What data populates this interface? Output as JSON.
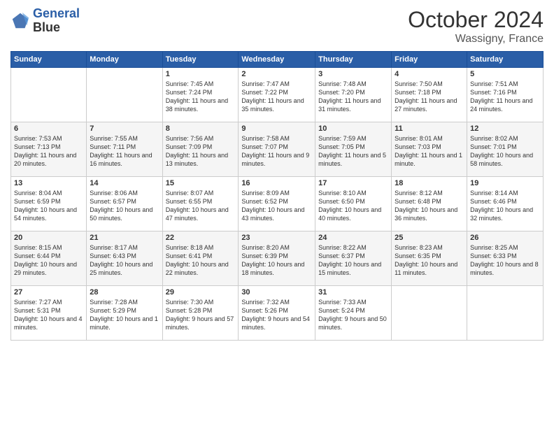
{
  "header": {
    "logo_line1": "General",
    "logo_line2": "Blue",
    "month": "October 2024",
    "location": "Wassigny, France"
  },
  "days_of_week": [
    "Sunday",
    "Monday",
    "Tuesday",
    "Wednesday",
    "Thursday",
    "Friday",
    "Saturday"
  ],
  "weeks": [
    [
      {
        "day": "",
        "sunrise": "",
        "sunset": "",
        "daylight": ""
      },
      {
        "day": "",
        "sunrise": "",
        "sunset": "",
        "daylight": ""
      },
      {
        "day": "1",
        "sunrise": "Sunrise: 7:45 AM",
        "sunset": "Sunset: 7:24 PM",
        "daylight": "Daylight: 11 hours and 38 minutes."
      },
      {
        "day": "2",
        "sunrise": "Sunrise: 7:47 AM",
        "sunset": "Sunset: 7:22 PM",
        "daylight": "Daylight: 11 hours and 35 minutes."
      },
      {
        "day": "3",
        "sunrise": "Sunrise: 7:48 AM",
        "sunset": "Sunset: 7:20 PM",
        "daylight": "Daylight: 11 hours and 31 minutes."
      },
      {
        "day": "4",
        "sunrise": "Sunrise: 7:50 AM",
        "sunset": "Sunset: 7:18 PM",
        "daylight": "Daylight: 11 hours and 27 minutes."
      },
      {
        "day": "5",
        "sunrise": "Sunrise: 7:51 AM",
        "sunset": "Sunset: 7:16 PM",
        "daylight": "Daylight: 11 hours and 24 minutes."
      }
    ],
    [
      {
        "day": "6",
        "sunrise": "Sunrise: 7:53 AM",
        "sunset": "Sunset: 7:13 PM",
        "daylight": "Daylight: 11 hours and 20 minutes."
      },
      {
        "day": "7",
        "sunrise": "Sunrise: 7:55 AM",
        "sunset": "Sunset: 7:11 PM",
        "daylight": "Daylight: 11 hours and 16 minutes."
      },
      {
        "day": "8",
        "sunrise": "Sunrise: 7:56 AM",
        "sunset": "Sunset: 7:09 PM",
        "daylight": "Daylight: 11 hours and 13 minutes."
      },
      {
        "day": "9",
        "sunrise": "Sunrise: 7:58 AM",
        "sunset": "Sunset: 7:07 PM",
        "daylight": "Daylight: 11 hours and 9 minutes."
      },
      {
        "day": "10",
        "sunrise": "Sunrise: 7:59 AM",
        "sunset": "Sunset: 7:05 PM",
        "daylight": "Daylight: 11 hours and 5 minutes."
      },
      {
        "day": "11",
        "sunrise": "Sunrise: 8:01 AM",
        "sunset": "Sunset: 7:03 PM",
        "daylight": "Daylight: 11 hours and 1 minute."
      },
      {
        "day": "12",
        "sunrise": "Sunrise: 8:02 AM",
        "sunset": "Sunset: 7:01 PM",
        "daylight": "Daylight: 10 hours and 58 minutes."
      }
    ],
    [
      {
        "day": "13",
        "sunrise": "Sunrise: 8:04 AM",
        "sunset": "Sunset: 6:59 PM",
        "daylight": "Daylight: 10 hours and 54 minutes."
      },
      {
        "day": "14",
        "sunrise": "Sunrise: 8:06 AM",
        "sunset": "Sunset: 6:57 PM",
        "daylight": "Daylight: 10 hours and 50 minutes."
      },
      {
        "day": "15",
        "sunrise": "Sunrise: 8:07 AM",
        "sunset": "Sunset: 6:55 PM",
        "daylight": "Daylight: 10 hours and 47 minutes."
      },
      {
        "day": "16",
        "sunrise": "Sunrise: 8:09 AM",
        "sunset": "Sunset: 6:52 PM",
        "daylight": "Daylight: 10 hours and 43 minutes."
      },
      {
        "day": "17",
        "sunrise": "Sunrise: 8:10 AM",
        "sunset": "Sunset: 6:50 PM",
        "daylight": "Daylight: 10 hours and 40 minutes."
      },
      {
        "day": "18",
        "sunrise": "Sunrise: 8:12 AM",
        "sunset": "Sunset: 6:48 PM",
        "daylight": "Daylight: 10 hours and 36 minutes."
      },
      {
        "day": "19",
        "sunrise": "Sunrise: 8:14 AM",
        "sunset": "Sunset: 6:46 PM",
        "daylight": "Daylight: 10 hours and 32 minutes."
      }
    ],
    [
      {
        "day": "20",
        "sunrise": "Sunrise: 8:15 AM",
        "sunset": "Sunset: 6:44 PM",
        "daylight": "Daylight: 10 hours and 29 minutes."
      },
      {
        "day": "21",
        "sunrise": "Sunrise: 8:17 AM",
        "sunset": "Sunset: 6:43 PM",
        "daylight": "Daylight: 10 hours and 25 minutes."
      },
      {
        "day": "22",
        "sunrise": "Sunrise: 8:18 AM",
        "sunset": "Sunset: 6:41 PM",
        "daylight": "Daylight: 10 hours and 22 minutes."
      },
      {
        "day": "23",
        "sunrise": "Sunrise: 8:20 AM",
        "sunset": "Sunset: 6:39 PM",
        "daylight": "Daylight: 10 hours and 18 minutes."
      },
      {
        "day": "24",
        "sunrise": "Sunrise: 8:22 AM",
        "sunset": "Sunset: 6:37 PM",
        "daylight": "Daylight: 10 hours and 15 minutes."
      },
      {
        "day": "25",
        "sunrise": "Sunrise: 8:23 AM",
        "sunset": "Sunset: 6:35 PM",
        "daylight": "Daylight: 10 hours and 11 minutes."
      },
      {
        "day": "26",
        "sunrise": "Sunrise: 8:25 AM",
        "sunset": "Sunset: 6:33 PM",
        "daylight": "Daylight: 10 hours and 8 minutes."
      }
    ],
    [
      {
        "day": "27",
        "sunrise": "Sunrise: 7:27 AM",
        "sunset": "Sunset: 5:31 PM",
        "daylight": "Daylight: 10 hours and 4 minutes."
      },
      {
        "day": "28",
        "sunrise": "Sunrise: 7:28 AM",
        "sunset": "Sunset: 5:29 PM",
        "daylight": "Daylight: 10 hours and 1 minute."
      },
      {
        "day": "29",
        "sunrise": "Sunrise: 7:30 AM",
        "sunset": "Sunset: 5:28 PM",
        "daylight": "Daylight: 9 hours and 57 minutes."
      },
      {
        "day": "30",
        "sunrise": "Sunrise: 7:32 AM",
        "sunset": "Sunset: 5:26 PM",
        "daylight": "Daylight: 9 hours and 54 minutes."
      },
      {
        "day": "31",
        "sunrise": "Sunrise: 7:33 AM",
        "sunset": "Sunset: 5:24 PM",
        "daylight": "Daylight: 9 hours and 50 minutes."
      },
      {
        "day": "",
        "sunrise": "",
        "sunset": "",
        "daylight": ""
      },
      {
        "day": "",
        "sunrise": "",
        "sunset": "",
        "daylight": ""
      }
    ]
  ]
}
